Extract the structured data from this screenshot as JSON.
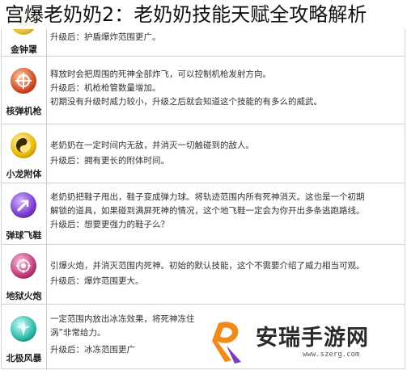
{
  "page_title": "宫爆老奶奶2：老奶奶技能天赋全攻略解析",
  "skills": [
    {
      "name": "金钟罩",
      "icon": "golden-bell-icon",
      "color": "#c9a020",
      "lines": [
        "升级后：护盾爆炸范围更广。"
      ]
    },
    {
      "name": "核弹机枪",
      "icon": "crosshair-icon",
      "color": "#c0392b",
      "lines": [
        "释放时会把周围的死神全部炸飞，可以控制机枪发射方向。",
        "升级后：机枪枪管数量增加。",
        "初期没有升级时威力较小，升级之后就会知道这个技能的有多么的威武。"
      ]
    },
    {
      "name": "小龙附体",
      "icon": "yin-yang-dragon-icon",
      "color": "#e0b400",
      "lines": [
        "老奶奶在一定时间内无敌，并消灭一切触碰到的敌人。",
        "升级后：拥有更长的附体时间。"
      ]
    },
    {
      "name": "弹球飞鞋",
      "icon": "bouncing-shoe-icon",
      "color": "#6a2db0",
      "lines": [
        "老奶奶把鞋子甩出，鞋子变成弹力球。将轨迹范围内所有死神消灭。这也是一个初期",
        "解锁的道具，如果碰到满屏死神的情况，这个地飞鞋一定会为你开出多条逃跑路线。",
        "升级后：想要更强力的鞋子么？"
      ]
    },
    {
      "name": "地狱火炮",
      "icon": "hell-cannon-icon",
      "color": "#b02a6a",
      "lines": [
        "引爆火炮，并消灭范围内死神。初始的默认技能，这个不需要介绍了威力相当可观。",
        "升级后：爆炸范围更大。"
      ]
    },
    {
      "name": "北极风暴",
      "icon": "ice-crystal-icon",
      "color": "#2aa8a0",
      "lines": [
        "一定范围内放出冰冻效果，将死神冻住",
        "涡”非常给力。",
        "升级后：冰冻范围更广"
      ]
    }
  ],
  "watermark": {
    "name": "安瑞手游网",
    "url": "www.szerg.com"
  }
}
